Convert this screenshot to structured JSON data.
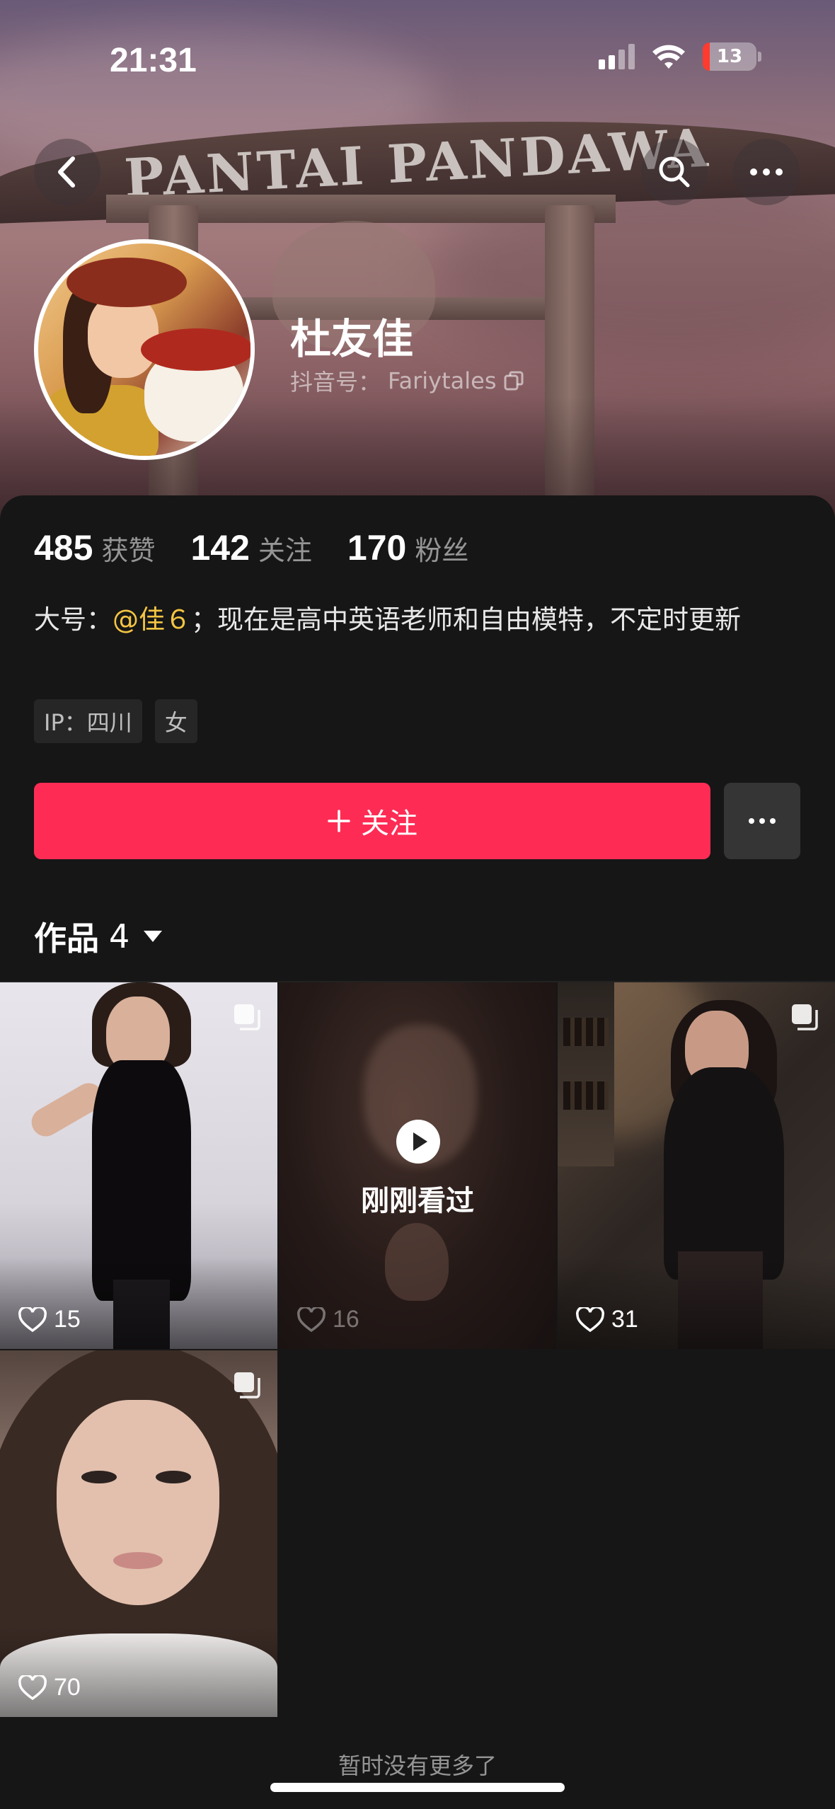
{
  "status_bar": {
    "time": "21:31",
    "battery": "13"
  },
  "banner": {
    "sign_text": "PANTAI PANDAWA"
  },
  "profile": {
    "name": "杜友佳",
    "id_label": "抖音号：",
    "id_value": "Fariytales"
  },
  "stats": [
    {
      "num": "485",
      "label": "获赞"
    },
    {
      "num": "142",
      "label": "关注"
    },
    {
      "num": "170",
      "label": "粉丝"
    }
  ],
  "bio": {
    "prefix": "大号：",
    "mention": "@佳６",
    "suffix": "；现在是高中英语老师和自由模特，不定时更新"
  },
  "tags": [
    "IP：四川",
    "女"
  ],
  "actions": {
    "follow_label": "关注"
  },
  "works": {
    "label": "作品",
    "count": "4"
  },
  "videos": [
    {
      "likes": "15",
      "multi": true
    },
    {
      "likes": "16",
      "watched_label": "刚刚看过"
    },
    {
      "likes": "31",
      "multi": true
    },
    {
      "likes": "70",
      "multi": true
    }
  ],
  "footer": {
    "text": "暂时没有更多了"
  },
  "colors": {
    "follow": "#fe2c55",
    "mention": "#f5c542",
    "background": "#161616"
  },
  "icons": [
    "back-icon",
    "search-icon",
    "more-icon",
    "copy-icon",
    "plus-icon",
    "heart-icon",
    "play-icon",
    "multi-image-icon",
    "caret-down-icon",
    "wifi-icon",
    "signal-icon",
    "battery-icon"
  ]
}
